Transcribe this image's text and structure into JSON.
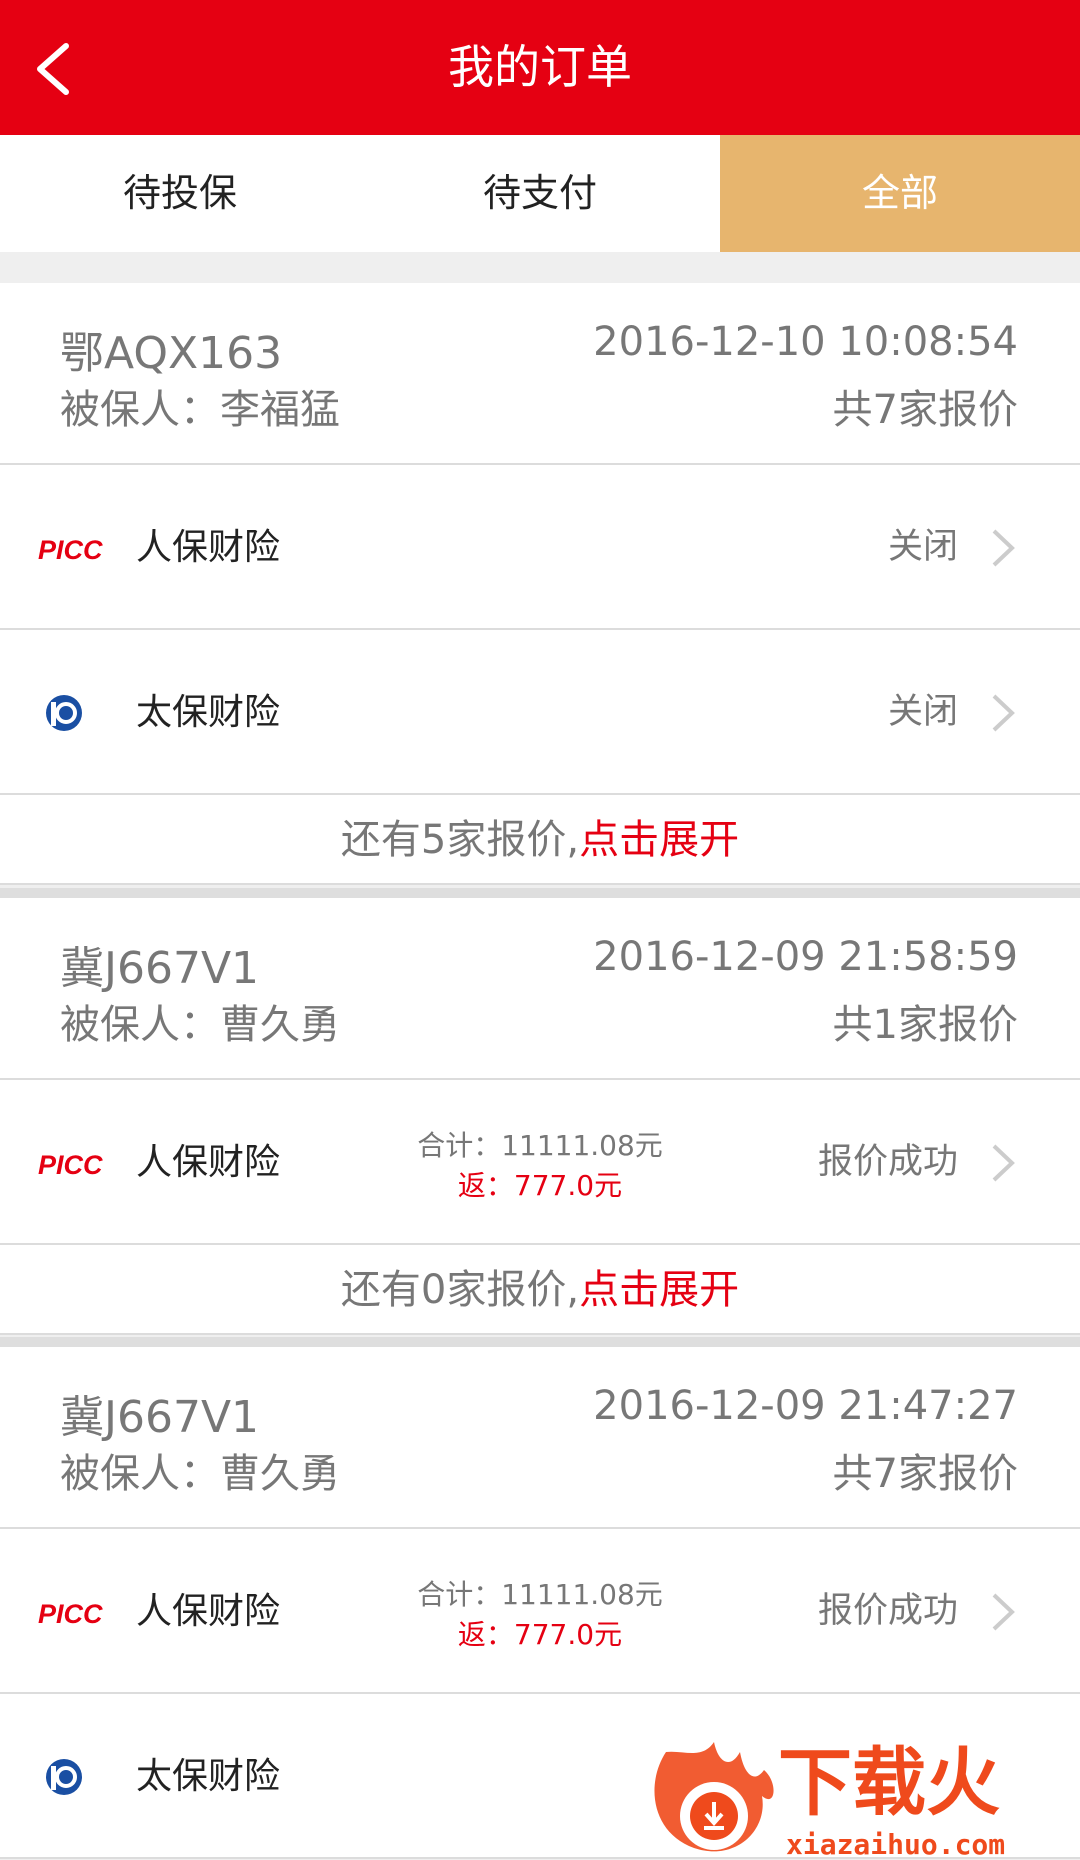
{
  "header": {
    "title": "我的订单"
  },
  "tabs": [
    {
      "label": "待投保",
      "active": false
    },
    {
      "label": "待支付",
      "active": false
    },
    {
      "label": "全部",
      "active": true
    }
  ],
  "orders": [
    {
      "plate": "鄂AQX163",
      "insured": "被保人：李福猛",
      "time": "2016-12-10 10:08:54",
      "quote_count": "共7家报价",
      "insurers": [
        {
          "logo": "picc-logo",
          "name": "人保财险",
          "status": "关闭"
        },
        {
          "logo": "cpic-logo",
          "name": "太保财险",
          "status": "关闭"
        }
      ],
      "expand": {
        "text": "还有5家报价,",
        "link": "点击展开"
      }
    },
    {
      "plate": "冀J667V1",
      "insured": "被保人：曹久勇",
      "time": "2016-12-09 21:58:59",
      "quote_count": "共1家报价",
      "insurers": [
        {
          "logo": "picc-logo",
          "name": "人保财险",
          "total": "合计：11111.08元",
          "rebate": "返：777.0元",
          "status": "报价成功"
        }
      ],
      "expand": {
        "text": "还有0家报价,",
        "link": "点击展开"
      }
    },
    {
      "plate": "冀J667V1",
      "insured": "被保人：曹久勇",
      "time": "2016-12-09 21:47:27",
      "quote_count": "共7家报价",
      "insurers": [
        {
          "logo": "picc-logo",
          "name": "人保财险",
          "total": "合计：11111.08元",
          "rebate": "返：777.0元",
          "status": "报价成功"
        },
        {
          "logo": "cpic-logo",
          "name": "太保财险"
        }
      ]
    }
  ],
  "picc_logo_text": "PICC",
  "watermark": {
    "brand": "下载火",
    "site": "xiazaihuo.com"
  },
  "colors": {
    "brand_red": "#e50012",
    "active_tab": "#e7b56e",
    "cpic_blue": "#1a4fa3"
  }
}
